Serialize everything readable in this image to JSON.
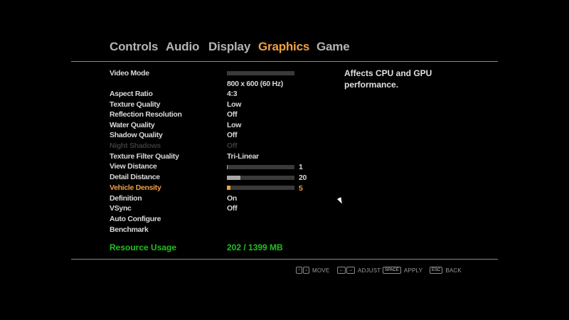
{
  "tabs": {
    "controls": "Controls",
    "audio": "Audio",
    "display": "Display",
    "graphics": "Graphics",
    "game": "Game"
  },
  "active_tab": "Graphics",
  "settings": {
    "video_mode": {
      "label": "Video Mode",
      "value": "800 x 600 (60 Hz)",
      "level": 0
    },
    "aspect_ratio": {
      "label": "Aspect Ratio",
      "value": "4:3"
    },
    "texture_quality": {
      "label": "Texture Quality",
      "value": "Low"
    },
    "reflection_resolution": {
      "label": "Reflection Resolution",
      "value": "Off"
    },
    "water_quality": {
      "label": "Water Quality",
      "value": "Low"
    },
    "shadow_quality": {
      "label": "Shadow Quality",
      "value": "Off"
    },
    "night_shadows": {
      "label": "Night Shadows",
      "value": "Off",
      "disabled": true
    },
    "texture_filter_quality": {
      "label": "Texture Filter Quality",
      "value": "Tri-Linear"
    },
    "view_distance": {
      "label": "View Distance",
      "value": "1",
      "level": 0.01
    },
    "detail_distance": {
      "label": "Detail Distance",
      "value": "20",
      "level": 0.2
    },
    "vehicle_density": {
      "label": "Vehicle Density",
      "value": "5",
      "level": 0.05,
      "selected": true
    },
    "definition": {
      "label": "Definition",
      "value": "On"
    },
    "vsync": {
      "label": "VSync",
      "value": "Off"
    },
    "auto_configure": {
      "label": "Auto Configure"
    },
    "benchmark": {
      "label": "Benchmark"
    }
  },
  "description": "Affects CPU and GPU performance.",
  "resource_usage": {
    "label": "Resource Usage",
    "value": "202 / 1399 MB"
  },
  "hints": {
    "move": {
      "keys": [
        "↑",
        "↓"
      ],
      "label": "MOVE"
    },
    "adjust": {
      "keys": [
        "←",
        "→"
      ],
      "label": "ADJUST"
    },
    "apply": {
      "keys": [
        "SPACE"
      ],
      "label": "APPLY"
    },
    "back": {
      "keys": [
        "ESC"
      ],
      "label": "BACK"
    }
  },
  "colors": {
    "accent": "#f0a040",
    "resource": "#20c020",
    "text": "#d8d8d8",
    "disabled": "#3a3a3a",
    "background": "#000000"
  },
  "icons": {
    "cursor": "mouse-pointer-icon"
  }
}
